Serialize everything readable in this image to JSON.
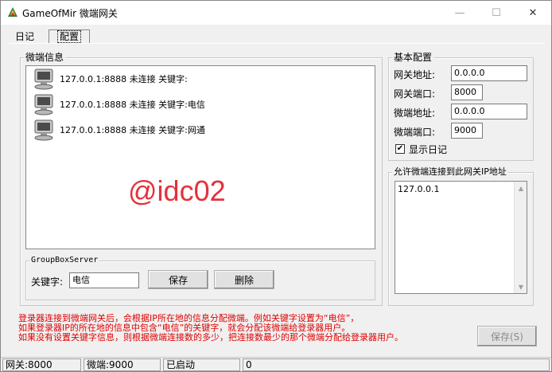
{
  "window": {
    "title": "GameOfMir 微端网关",
    "minimize_glyph": "—",
    "maximize_glyph": "☐",
    "close_glyph": "✕"
  },
  "tabs": [
    {
      "label": "日记",
      "active": false
    },
    {
      "label": "配置",
      "active": true
    }
  ],
  "microclient_info": {
    "title": "微端信息",
    "items": [
      {
        "icon": "computer-icon",
        "text": "127.0.0.1:8888 未连接 关键字:"
      },
      {
        "icon": "computer-icon",
        "text": "127.0.0.1:8888 未连接 关键字:电信"
      },
      {
        "icon": "computer-icon",
        "text": "127.0.0.1:8888 未连接 关键字:网通"
      }
    ],
    "watermark": "@idc02"
  },
  "group_box_server": {
    "title": "GroupBoxServer",
    "keyword_label": "关键字:",
    "keyword_value": "电信",
    "save_label": "保存",
    "delete_label": "删除"
  },
  "basic_config": {
    "title": "基本配置",
    "gateway_addr_label": "网关地址:",
    "gateway_addr_value": "0.0.0.0",
    "gateway_port_label": "网关端口:",
    "gateway_port_value": "8000",
    "micro_addr_label": "微端地址:",
    "micro_addr_value": "0.0.0.0",
    "micro_port_label": "微端端口:",
    "micro_port_value": "9000",
    "show_log_label": "显示日记",
    "show_log_checked": true
  },
  "allowed_ips": {
    "title": "允许微端连接到此网关IP地址",
    "value": "127.0.0.1"
  },
  "help_text": [
    "登录器连接到微端网关后，会根据IP所在地的信息分配微端。例如关键字设置为“电信”，",
    "如果登录器IP的所在地的信息中包含“电信”的关键字，就会分配该微端给登录器用户。",
    "如果没有设置关键字信息，则根据微端连接数的多少，把连接数最少的那个微端分配给登录器用户。"
  ],
  "save_button_label": "保存(S)",
  "statusbar": {
    "gateway": "网关:8000",
    "micro": "微端:9000",
    "state": "已启动",
    "count": "0"
  },
  "colors": {
    "help_text": "#e00000",
    "watermark": "#e3323c",
    "window_bg": "#f0f0f0"
  }
}
